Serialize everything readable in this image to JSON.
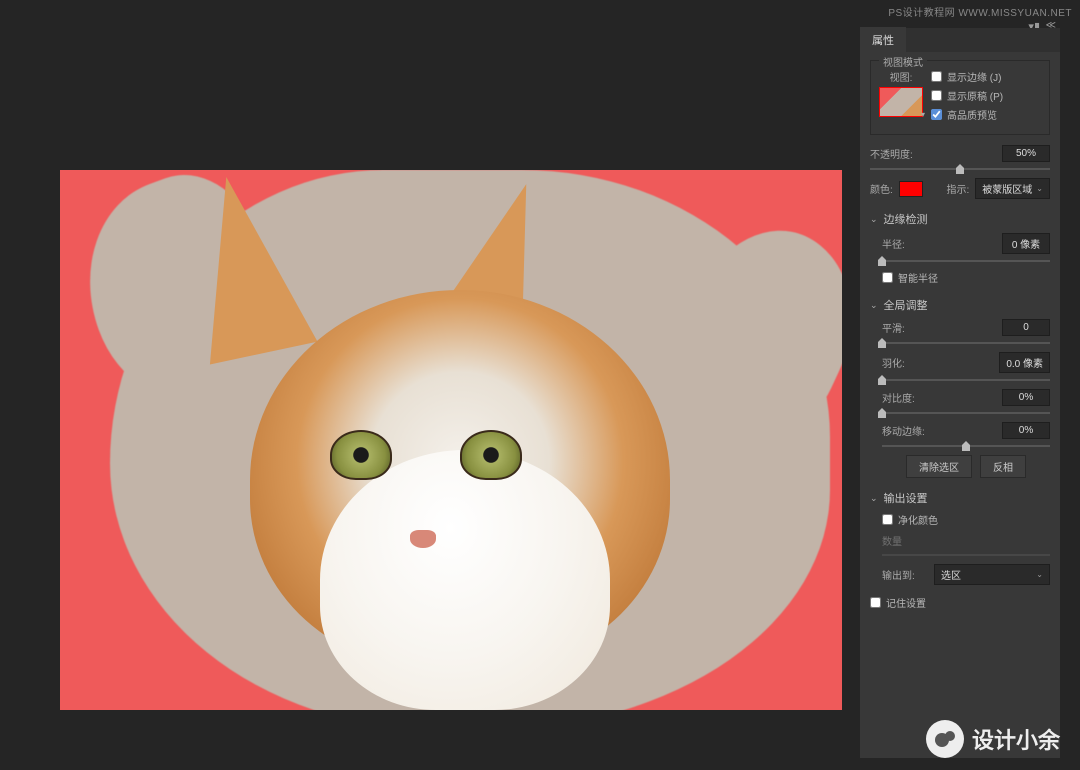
{
  "watermark_top": "PS设计教程网   WWW.MISSYUAN.NET",
  "watermark_bottom": "设计小余",
  "panel": {
    "tab_title": "属性",
    "view_mode": {
      "group_label": "视图模式",
      "thumbnail_label": "视图:",
      "show_edge": "显示边缘 (J)",
      "show_original": "显示原稿 (P)",
      "high_quality": "高品质预览"
    },
    "opacity": {
      "label": "不透明度:",
      "value": "50%"
    },
    "color_label": "颜色:",
    "indicate": {
      "label": "指示:",
      "value": "被蒙版区域"
    },
    "edge_detection": {
      "title": "边缘检测",
      "radius_label": "半径:",
      "radius_value": "0 像素",
      "smart_radius": "智能半径"
    },
    "global_adjust": {
      "title": "全局调整",
      "smooth_label": "平滑:",
      "smooth_value": "0",
      "feather_label": "羽化:",
      "feather_value": "0.0 像素",
      "contrast_label": "对比度:",
      "contrast_value": "0%",
      "shift_label": "移动边缘:",
      "shift_value": "0%",
      "clear_btn": "清除选区",
      "invert_btn": "反相"
    },
    "output": {
      "title": "输出设置",
      "purify": "净化颜色",
      "amount_label": "数量",
      "output_to_label": "输出到:",
      "output_to_value": "选区",
      "remember": "记住设置"
    }
  }
}
